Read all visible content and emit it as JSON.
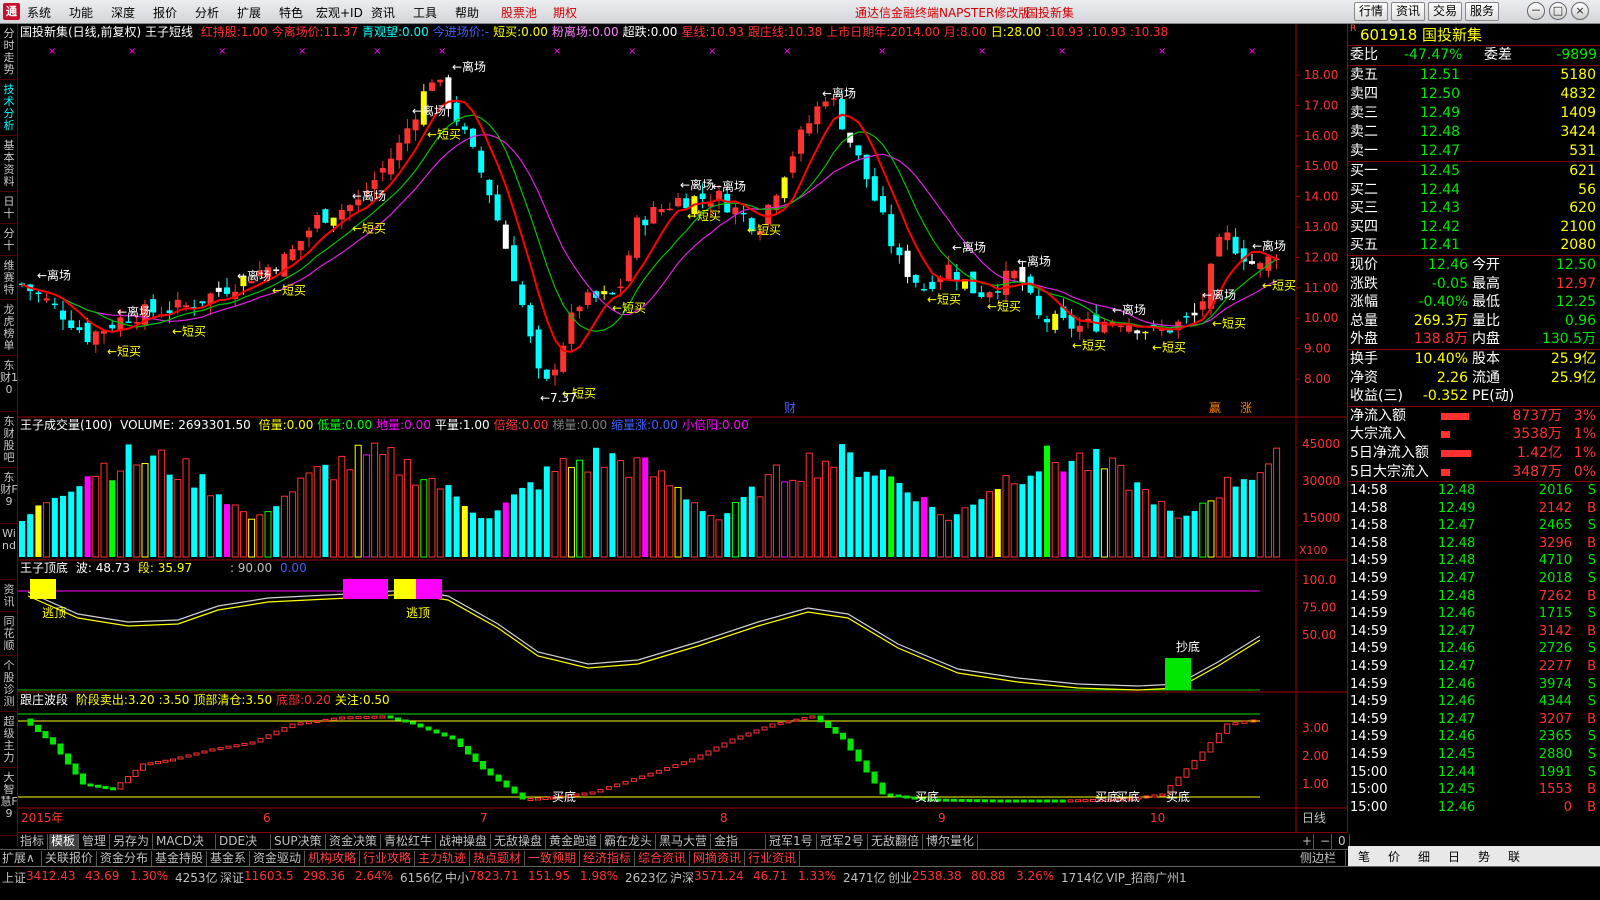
{
  "menubar": {
    "items": [
      "系统",
      "功能",
      "深度",
      "报价",
      "分析",
      "扩展",
      "特色",
      "宏观+ID",
      "资讯",
      "工具",
      "帮助"
    ],
    "red_items": [
      "股票池",
      "期权"
    ],
    "notice": "通达信金融终端NAPSTER修改版",
    "stock_notice": "国投新集",
    "right_buttons": [
      "行情",
      "资讯",
      "交易",
      "服务"
    ],
    "window_buttons": [
      "－",
      "□",
      "×"
    ]
  },
  "left_tabs": [
    "分时走势",
    "技术分析",
    "基本资料",
    "日十",
    "分十",
    "维赛特",
    "龙虎榜单",
    "东财10",
    "东财股吧",
    "东财F9",
    "Wind",
    "资讯",
    "同花顺",
    "个股诊测",
    "超级主力",
    "大智慧F9"
  ],
  "header": {
    "title": "国投新集(日线,前复权) 王子短线",
    "items": [
      {
        "label": "红持股:",
        "value": "1.00",
        "color": "#ff3232"
      },
      {
        "label": "今离场价:",
        "value": "11.37",
        "color": "#ff3232"
      },
      {
        "label": "青观望:",
        "value": "0.00",
        "color": "#00ffff"
      },
      {
        "label": "今进场价:",
        "value": "-",
        "color": "#4060ff"
      },
      {
        "label": "短买:",
        "value": "0.00",
        "color": "#ffff00"
      },
      {
        "label": "粉离场:",
        "value": "0.00",
        "color": "#ff80ff"
      },
      {
        "label": "超跌:",
        "value": "0.00",
        "color": "#ffffff"
      },
      {
        "label": "星线:",
        "value": "10.93",
        "color": "#ff3232"
      },
      {
        "label": "跟庄线:",
        "value": "10.38",
        "color": "#ff3232"
      },
      {
        "label": "上市日期年:",
        "value": "2014.00",
        "color": "#ff3232"
      },
      {
        "label": "月:",
        "value": "8.00",
        "color": "#ff3232"
      },
      {
        "label": "日:",
        "value": "28.00",
        "color": "#ffff00"
      },
      {
        "label": ":",
        "value": "10.93",
        "color": "#ff3232"
      },
      {
        "label": ":",
        "value": "10.93",
        "color": "#ff3232"
      },
      {
        "label": ":",
        "value": "10.38",
        "color": "#ff3232"
      }
    ]
  },
  "price_axis": [
    "18.00",
    "17.00",
    "16.00",
    "15.00",
    "14.00",
    "13.00",
    "12.00",
    "11.00",
    "10.00",
    "9.00",
    "8.00"
  ],
  "price_labels": {
    "leave": "←离场",
    "buy": "←短买",
    "low": "←7.37",
    "fin": "财",
    "ying": "赢",
    "zhang": "涨"
  },
  "volume_header": {
    "title": "王子成交量(100)",
    "volume": "VOLUME: 2693301.50",
    "items": [
      {
        "label": "倍量:",
        "value": "0.00",
        "color": "#ffff00"
      },
      {
        "label": "低量:",
        "value": "0.00",
        "color": "#00ff00"
      },
      {
        "label": "地量:",
        "value": "0.00",
        "color": "#ff00ff"
      },
      {
        "label": "平量:",
        "value": "1.00",
        "color": "#ffffff"
      },
      {
        "label": "倍缩:",
        "value": "0.00",
        "color": "#ff3232"
      },
      {
        "label": "梯量:",
        "value": "0.00",
        "color": "#808080"
      },
      {
        "label": "缩量涨:",
        "value": "0.00",
        "color": "#4060ff"
      },
      {
        "label": "小倍阳:",
        "value": "0.00",
        "color": "#ff00ff"
      }
    ],
    "axis": [
      "45000",
      "30000",
      "15000"
    ],
    "unit": "X100"
  },
  "wave_header": {
    "title": "王子顶底",
    "wave": "波: 48.73",
    "seg": "段: 35.97",
    "v1": ": 90.00",
    "v2": "0.00",
    "axis": [
      "100.0",
      "75.00",
      "50.00"
    ],
    "escape": "逃顶",
    "bottom": "抄底"
  },
  "follow_header": {
    "title": "跟庄波段",
    "items": [
      {
        "label": "阶段卖出:",
        "value": "3.20",
        "color": "#ffff00"
      },
      {
        "label": ":",
        "value": "3.50",
        "color": "#ffff00"
      },
      {
        "label": "顶部清仓:",
        "value": "3.50",
        "color": "#ffff00"
      },
      {
        "label": "底部:",
        "value": "0.20",
        "color": "#ff3232"
      },
      {
        "label": "关注:",
        "value": "0.50",
        "color": "#ffff00"
      }
    ],
    "axis": [
      "3.00",
      "2.00",
      "1.00"
    ],
    "buy_bottom": "买底"
  },
  "date_axis": {
    "year": "2015年",
    "months": [
      "6",
      "7",
      "8",
      "9",
      "10"
    ],
    "period": "日线"
  },
  "quote": {
    "code": "601918",
    "name": "国投新集",
    "weibi": {
      "label": "委比",
      "value": "-47.47%",
      "label2": "委差",
      "value2": "-9899"
    },
    "asks": [
      {
        "label": "卖五",
        "price": "12.51",
        "vol": "5180"
      },
      {
        "label": "卖四",
        "price": "12.50",
        "vol": "4832"
      },
      {
        "label": "卖三",
        "price": "12.49",
        "vol": "1409"
      },
      {
        "label": "卖二",
        "price": "12.48",
        "vol": "3424"
      },
      {
        "label": "卖一",
        "price": "12.47",
        "vol": "531"
      }
    ],
    "bids": [
      {
        "label": "买一",
        "price": "12.45",
        "vol": "621"
      },
      {
        "label": "买二",
        "price": "12.44",
        "vol": "56"
      },
      {
        "label": "买三",
        "price": "12.43",
        "vol": "620"
      },
      {
        "label": "买四",
        "price": "12.42",
        "vol": "2100"
      },
      {
        "label": "买五",
        "price": "12.41",
        "vol": "2080"
      }
    ],
    "stats": [
      {
        "l1": "现价",
        "v1": "12.46",
        "c1": "#00e600",
        "l2": "今开",
        "v2": "12.50",
        "c2": "#00e600"
      },
      {
        "l1": "涨跌",
        "v1": "-0.05",
        "c1": "#00e600",
        "l2": "最高",
        "v2": "12.97",
        "c2": "#ff3232"
      },
      {
        "l1": "涨幅",
        "v1": "-0.40%",
        "c1": "#00e600",
        "l2": "最低",
        "v2": "12.25",
        "c2": "#00e600"
      },
      {
        "l1": "总量",
        "v1": "269.3万",
        "c1": "#ffff00",
        "l2": "量比",
        "v2": "0.96",
        "c2": "#00e600"
      },
      {
        "l1": "外盘",
        "v1": "138.8万",
        "c1": "#ff3232",
        "l2": "内盘",
        "v2": "130.5万",
        "c2": "#00e600"
      }
    ],
    "stats2": [
      {
        "l1": "换手",
        "v1": "10.40%",
        "c1": "#ffff00",
        "l2": "股本",
        "v2": "25.9亿",
        "c2": "#ffff00"
      },
      {
        "l1": "净资",
        "v1": "2.26",
        "c1": "#ffff00",
        "l2": "流通",
        "v2": "25.9亿",
        "c2": "#ffff00"
      },
      {
        "l1": "收益(三)",
        "v1": "-0.352",
        "c1": "#ffff00",
        "l2": "PE(动)",
        "v2": "",
        "c2": "#ffff00"
      }
    ],
    "flows": [
      {
        "label": "净流入额",
        "value": "8737万",
        "pct": "3%",
        "bar": 0.55
      },
      {
        "label": "大宗流入",
        "value": "3538万",
        "pct": "1%",
        "bar": 0.18
      },
      {
        "label": "5日净流入额",
        "value": "1.42亿",
        "pct": "1%",
        "bar": 0.6
      },
      {
        "label": "5日大宗流入",
        "value": "3487万",
        "pct": "0%",
        "bar": 0.18
      }
    ],
    "ticks": [
      {
        "t": "14:58",
        "p": "12.48",
        "v": "2016",
        "d": "S"
      },
      {
        "t": "14:58",
        "p": "12.49",
        "v": "2142",
        "d": "B"
      },
      {
        "t": "14:58",
        "p": "12.47",
        "v": "2465",
        "d": "S"
      },
      {
        "t": "14:58",
        "p": "12.48",
        "v": "3296",
        "d": "B"
      },
      {
        "t": "14:59",
        "p": "12.48",
        "v": "4710",
        "d": "S"
      },
      {
        "t": "14:59",
        "p": "12.47",
        "v": "2018",
        "d": "S"
      },
      {
        "t": "14:59",
        "p": "12.48",
        "v": "7262",
        "d": "B"
      },
      {
        "t": "14:59",
        "p": "12.46",
        "v": "1715",
        "d": "S"
      },
      {
        "t": "14:59",
        "p": "12.47",
        "v": "3142",
        "d": "B"
      },
      {
        "t": "14:59",
        "p": "12.46",
        "v": "2726",
        "d": "S"
      },
      {
        "t": "14:59",
        "p": "12.47",
        "v": "2277",
        "d": "B"
      },
      {
        "t": "14:59",
        "p": "12.46",
        "v": "3974",
        "d": "S"
      },
      {
        "t": "14:59",
        "p": "12.46",
        "v": "4344",
        "d": "S"
      },
      {
        "t": "14:59",
        "p": "12.47",
        "v": "3207",
        "d": "B"
      },
      {
        "t": "14:59",
        "p": "12.46",
        "v": "2365",
        "d": "S"
      },
      {
        "t": "14:59",
        "p": "12.45",
        "v": "2880",
        "d": "S"
      },
      {
        "t": "15:00",
        "p": "12.44",
        "v": "1991",
        "d": "S"
      },
      {
        "t": "15:00",
        "p": "12.45",
        "v": "1553",
        "d": "B"
      },
      {
        "t": "15:00",
        "p": "12.46",
        "v": "0",
        "d": "B"
      }
    ],
    "tabs": [
      "笔",
      "价",
      "细",
      "日",
      "势",
      "联"
    ]
  },
  "bottom_tabs1": [
    "指标",
    "模板",
    "管理",
    "另存为",
    "MACD决策",
    "DDE决策",
    "SUP决策",
    "资金决策",
    "青松红牛",
    "战神操盘",
    "无敌操盘",
    "黄金跑道",
    "霸在龙头",
    "黑马大营",
    "金指DDE",
    "冠军1号",
    "冠军2号",
    "无敌翻倍",
    "博尔量化"
  ],
  "bottom_tabs1_right": [
    "+",
    "−",
    "0"
  ],
  "bottom_tabs2": [
    "扩展∧",
    "关联报价",
    "资金分布",
    "基金持股",
    "基金系",
    "资金驱动",
    "机构攻略",
    "行业攻略",
    "主力轨迹",
    "热点题材",
    "一致预期",
    "经济指标",
    "综合资讯",
    "网摘资讯",
    "行业资讯"
  ],
  "bottom_tabs2_right": "侧边栏<",
  "status": [
    {
      "text": "上证",
      "c": "#c0c0c0"
    },
    {
      "text": "3412.43",
      "c": "#ff3232"
    },
    {
      "text": "43.69",
      "c": "#ff3232"
    },
    {
      "text": "1.30%",
      "c": "#ff3232"
    },
    {
      "text": "4253亿",
      "c": "#c0c0c0"
    },
    {
      "text": "深证",
      "c": "#c0c0c0"
    },
    {
      "text": "11603.5",
      "c": "#ff3232"
    },
    {
      "text": "298.36",
      "c": "#ff3232"
    },
    {
      "text": "2.64%",
      "c": "#ff3232"
    },
    {
      "text": "6156亿",
      "c": "#c0c0c0"
    },
    {
      "text": "中小",
      "c": "#c0c0c0"
    },
    {
      "text": "7823.71",
      "c": "#ff3232"
    },
    {
      "text": "151.95",
      "c": "#ff3232"
    },
    {
      "text": "1.98%",
      "c": "#ff3232"
    },
    {
      "text": "2623亿",
      "c": "#c0c0c0"
    },
    {
      "text": "沪深",
      "c": "#c0c0c0"
    },
    {
      "text": "3571.24",
      "c": "#ff3232"
    },
    {
      "text": "46.71",
      "c": "#ff3232"
    },
    {
      "text": "1.33%",
      "c": "#ff3232"
    },
    {
      "text": "2471亿",
      "c": "#c0c0c0"
    },
    {
      "text": "创业",
      "c": "#c0c0c0"
    },
    {
      "text": "2538.38",
      "c": "#ff3232"
    },
    {
      "text": "80.88",
      "c": "#ff3232"
    },
    {
      "text": "3.26%",
      "c": "#ff3232"
    },
    {
      "text": "1714亿",
      "c": "#c0c0c0"
    },
    {
      "text": "VIP_招商广州1",
      "c": "#c0c0c0"
    }
  ],
  "colors": {
    "up": "#ff3232",
    "down": "#00ffff",
    "ma_red": "#ff0000",
    "ma_green": "#00c000",
    "ma_mag": "#e020e0"
  }
}
